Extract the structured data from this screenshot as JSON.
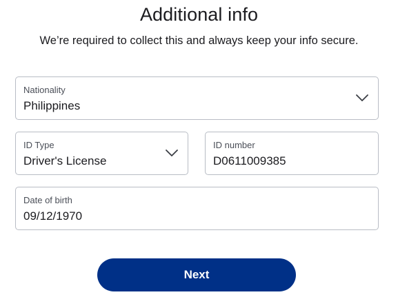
{
  "header": {
    "title": "Additional info",
    "subtitle": "We’re required to collect this and always keep your info secure."
  },
  "form": {
    "nationality": {
      "label": "Nationality",
      "value": "Philippines",
      "icon": "chevron-down-icon"
    },
    "id_type": {
      "label": "ID Type",
      "value": "Driver's License",
      "icon": "chevron-down-icon"
    },
    "id_number": {
      "label": "ID number",
      "value": "D0611009385"
    },
    "date_of_birth": {
      "label": "Date of birth",
      "value": "09/12/1970"
    }
  },
  "actions": {
    "next_label": "Next"
  },
  "colors": {
    "primary_button": "#003087",
    "field_border": "#b8bcc4",
    "text": "#1b1b1f"
  }
}
